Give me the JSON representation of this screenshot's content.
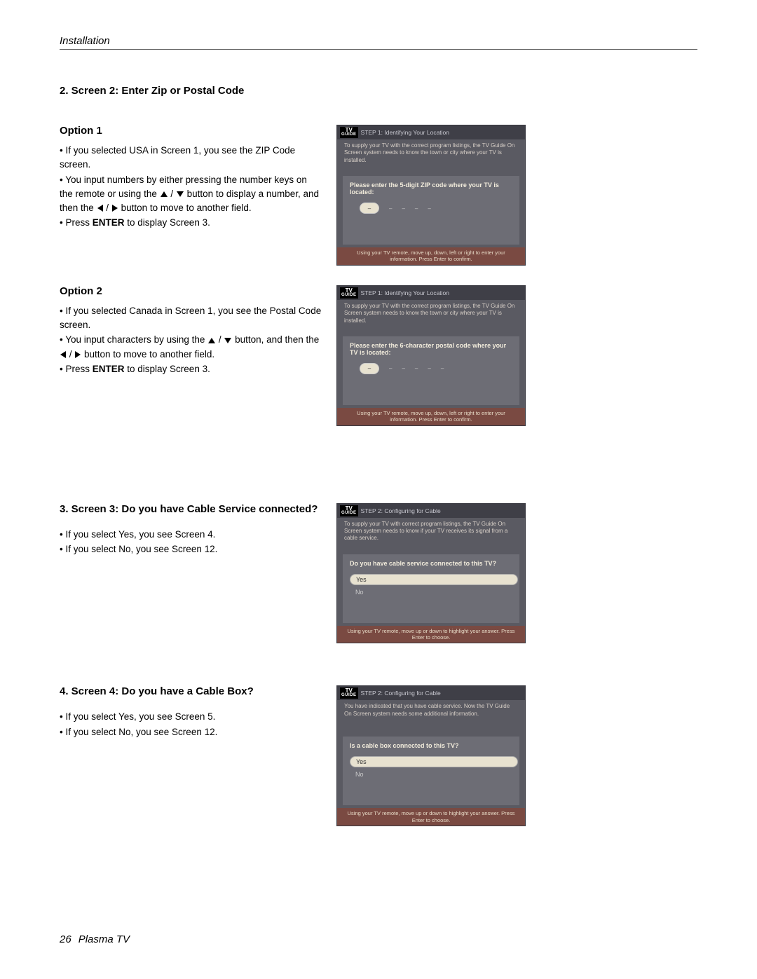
{
  "header": {
    "section": "Installation"
  },
  "section2": {
    "heading": "2. Screen 2: Enter Zip or Postal Code",
    "option1": {
      "label": "Option 1",
      "b1": "• If you selected USA in Screen 1, you see the ZIP Code screen.",
      "b2a": "• You input numbers by either pressing the number keys on the remote or using the ",
      "b2b": " button to display a number, and then the ",
      "b2c": " button to move to another field.",
      "b3a": "• Press ",
      "b3_enter": "ENTER",
      "b3b": " to display Screen 3."
    },
    "option2": {
      "label": "Option 2",
      "b1": "• If you selected Canada in Screen 1, you see the Postal Code screen.",
      "b2a": "• You input characters by using the ",
      "b2b": " button, and then the ",
      "b2c": " button to move to another field.",
      "b3a": "• Press ",
      "b3_enter": "ENTER",
      "b3b": " to display Screen 3."
    }
  },
  "section3": {
    "heading": "3. Screen 3: Do you have Cable Service connected?",
    "b1": "• If you select Yes, you see Screen 4.",
    "b2": "• If you select No, you see Screen 12."
  },
  "section4": {
    "heading": "4. Screen 4: Do you have a Cable Box?",
    "b1": "• If you select Yes, you see Screen 5.",
    "b2": "• If you select No, you see Screen 12."
  },
  "shot_zip": {
    "title": "STEP 1: Identifying Your Location",
    "desc": "To supply your TV with the correct program listings, the TV Guide On Screen system needs to know the town or city where your TV is installed.",
    "prompt": "Please enter the 5-digit ZIP code where your TV is located:",
    "footer": "Using your TV remote, move up, down, left or right to enter your information. Press Enter to confirm."
  },
  "shot_postal": {
    "title": "STEP 1: Identifying Your Location",
    "desc": "To supply your TV with the correct program listings, the TV Guide On Screen system needs to know the town or city where your TV is installed.",
    "prompt": "Please enter the 6-character postal code where your TV is located:",
    "footer": "Using your TV remote, move up, down, left or right to enter your information. Press Enter to confirm."
  },
  "shot_cable": {
    "title": "STEP 2: Configuring for Cable",
    "desc": "To supply your TV with correct program listings, the TV Guide On Screen system needs to know if your TV receives its signal from a cable service.",
    "prompt": "Do you have cable service connected to this TV?",
    "yes": "Yes",
    "no": "No",
    "footer": "Using your TV remote, move up or down to highlight your answer. Press Enter to choose."
  },
  "shot_cablebox": {
    "title": "STEP 2: Configuring for Cable",
    "desc": "You have indicated that you have cable service. Now the TV Guide On Screen system needs some additional information.",
    "prompt": "Is a cable box connected to this TV?",
    "yes": "Yes",
    "no": "No",
    "footer": "Using your TV remote, move up or down to highlight your answer. Press Enter to choose."
  },
  "tvlogo": {
    "top": "TV",
    "bot": "GUIDE"
  },
  "footer": {
    "page": "26",
    "label": "Plasma TV"
  },
  "glyphs": {
    "slash": " / ",
    "dash": "–"
  }
}
